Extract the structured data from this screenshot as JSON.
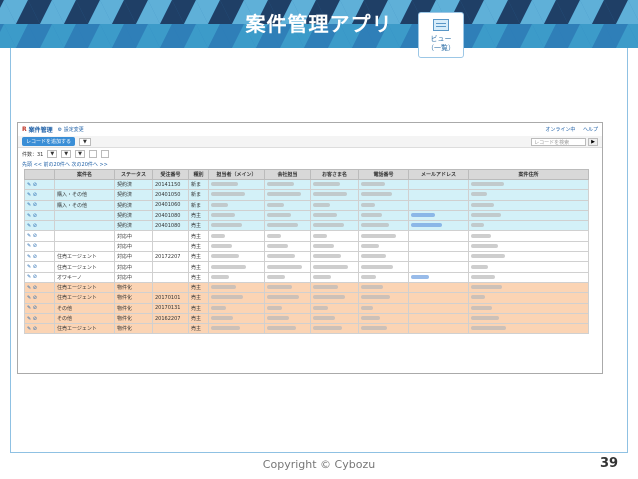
{
  "slide": {
    "title": "案件管理アプリ",
    "view_icon_line1": "ビュー",
    "view_icon_line2": "（一覧）",
    "copyright": "Copyright © Cybozu",
    "page_number": "39"
  },
  "colors": {
    "banner_dark": "#1f3f66",
    "banner_mid": "#2f7fb8",
    "banner_light": "#5fb0d8",
    "row_cyan": "#d3f1f8",
    "row_orange": "#fbd4b4",
    "accent": "#3a8ed6"
  },
  "app": {
    "name": "案件管理",
    "settings_link": "⚙ 設定変更",
    "header_right": [
      "オンライン中",
      "ヘルプ"
    ],
    "add_button": "レコードを追加する",
    "search_placeholder": "レコードを検索",
    "filter_count": "件数：31",
    "pager": "先頭 << 前の20件へ 次の20件へ >>",
    "columns": [
      "",
      "案件名",
      "ステータス",
      "受注番号",
      "種別",
      "担当者（メイン）",
      "会社担当",
      "お客さま名",
      "電話番号",
      "メールアドレス",
      "案件住所"
    ],
    "rows": [
      {
        "style": "cyan",
        "name": "",
        "status": "契約済",
        "order": "20141150",
        "type": "新ま"
      },
      {
        "style": "cyan",
        "name": "購入・その他",
        "status": "契約済",
        "order": "20401050",
        "type": "新ま"
      },
      {
        "style": "cyan",
        "name": "購入・その他",
        "status": "契約済",
        "order": "20401060",
        "type": "新ま"
      },
      {
        "style": "cyan",
        "name": "",
        "status": "契約済",
        "order": "20401080",
        "type": "売主"
      },
      {
        "style": "cyan",
        "name": "",
        "status": "契約済",
        "order": "20401080",
        "type": "売主"
      },
      {
        "style": "white",
        "name": "",
        "status": "対応中",
        "order": "",
        "type": "売主"
      },
      {
        "style": "white",
        "name": "",
        "status": "対応中",
        "order": "",
        "type": "売主"
      },
      {
        "style": "white",
        "name": "住売エージェント",
        "status": "対応中",
        "order": "20172207",
        "type": "売主"
      },
      {
        "style": "white",
        "name": "住売エージェント",
        "status": "対応中",
        "order": "",
        "type": "売主"
      },
      {
        "style": "white",
        "name": "オワキーノ",
        "status": "対応中",
        "order": "",
        "type": "売主"
      },
      {
        "style": "orange",
        "name": "住売エージェント",
        "status": "物件化",
        "order": "",
        "type": "売主"
      },
      {
        "style": "orange",
        "name": "住売エージェント",
        "status": "物件化",
        "order": "20170101",
        "type": "売主"
      },
      {
        "style": "orange",
        "name": "その他",
        "status": "物件化",
        "order": "20170131",
        "type": "売主"
      },
      {
        "style": "orange",
        "name": "その他",
        "status": "物件化",
        "order": "20162207",
        "type": "売主"
      },
      {
        "style": "orange",
        "name": "住売エージェント",
        "status": "物件化",
        "order": "",
        "type": "売主"
      }
    ]
  }
}
